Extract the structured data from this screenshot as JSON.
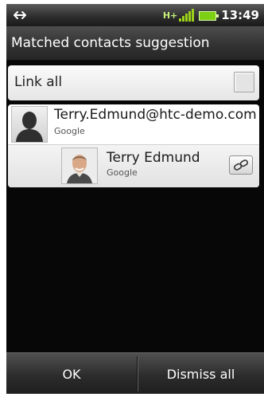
{
  "status_bar": {
    "time": "13:49",
    "left_icon": "usb-sync-icon",
    "signal_icon": "signal-strength-icon",
    "network_type": "H+",
    "battery_icon": "battery-icon",
    "accent_color": "#9cd21a"
  },
  "header": {
    "title": "Matched contacts suggestion"
  },
  "link_all": {
    "label": "Link all",
    "checked": false
  },
  "contacts": [
    {
      "name": "Terry.Edmund@htc-demo.com",
      "account": "Google",
      "avatar": "default-person-icon"
    },
    {
      "name": "Terry Edmund",
      "account": "Google",
      "avatar": "contact-photo",
      "action_icon": "link-icon"
    }
  ],
  "buttons": {
    "ok": "OK",
    "dismiss": "Dismiss all"
  }
}
